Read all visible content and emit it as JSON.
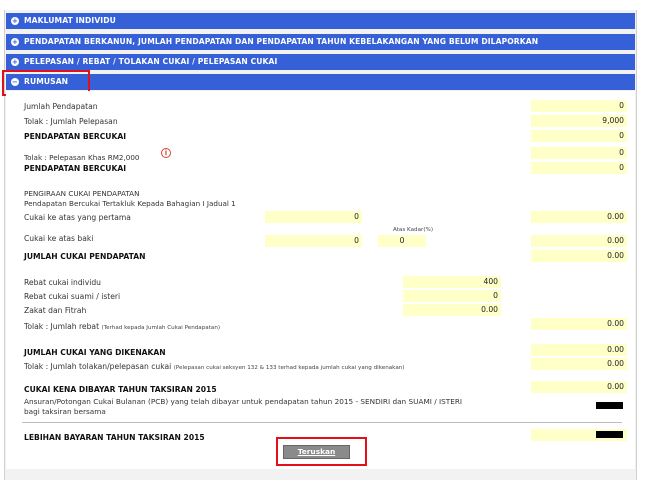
{
  "sections": [
    {
      "label": "MAKLUMAT INDIVIDU",
      "icon": "plus-icon"
    },
    {
      "label": "PENDAPATAN BERKANUN, JUMLAH PENDAPATAN DAN PENDAPATAN TAHUN KEBELAKANGAN YANG BELUM DILAPORKAN",
      "icon": "plus-icon"
    },
    {
      "label": "PELEPASAN / REBAT / TOLAKAN CUKAI / PELEPASAN CUKAI",
      "icon": "plus-icon"
    },
    {
      "label": "RUMUSAN",
      "icon": "minus-icon"
    }
  ],
  "summary": {
    "jumlah_pendapatan": {
      "label": "Jumlah Pendapatan",
      "value": "0"
    },
    "tolak_jumlah_pelepasan": {
      "label": "Tolak : Jumlah Pelepasan",
      "value": "9,000"
    },
    "pendapatan_bercukai_1": {
      "label": "PENDAPATAN BERCUKAI",
      "value": "0"
    },
    "pelepasan_khas": {
      "label": "Tolak : Pelepasan Khas RM2,000",
      "value": "0"
    },
    "pendapatan_bercukai_2": {
      "label": "PENDAPATAN BERCUKAI",
      "value": "0"
    },
    "pengiraan_title": "PENGIRAAN CUKAI PENDAPATAN",
    "pengiraan_sub": "Pendapatan Bercukai Tertakluk Kepada Bahagian I Jadual 1",
    "cukai_pertama": {
      "label": "Cukai ke atas yang pertama",
      "amount": "0",
      "value": "0.00"
    },
    "kadar_label": "Atas Kadar(%)",
    "cukai_baki": {
      "label": "Cukai ke atas baki",
      "amount": "0",
      "rate": "0",
      "value": "0.00"
    },
    "jumlah_cukai_pendapatan": {
      "label": "JUMLAH CUKAI PENDAPATAN",
      "value": "0.00"
    },
    "rebat_individu": {
      "label": "Rebat cukai individu",
      "value": "400"
    },
    "rebat_suami_isteri": {
      "label": "Rebat cukai suami / isteri",
      "value": "0"
    },
    "zakat": {
      "label": "Zakat dan Fitrah",
      "value": "0.00"
    },
    "tolak_jumlah_rebat": {
      "label": "Tolak : Jumlah rebat",
      "note": "(Terhad kepada Jumlah Cukai Pendapatan)",
      "value": "0.00"
    },
    "jumlah_cukai_dikenakan": {
      "label": "JUMLAH CUKAI YANG DIKENAKAN",
      "value": "0.00"
    },
    "tolakan_pelepasan": {
      "label": "Tolak : Jumlah tolakan/pelepasan cukai",
      "note": "(Pelepasan cukai seksyen 132 & 133 terhad kepada jumlah cukai yang dikenakan)",
      "value": "0.00"
    },
    "cukai_kena_dibayar": {
      "label": "CUKAI KENA DIBAYAR TAHUN TAKSIRAN 2015",
      "value": "0.00"
    },
    "pcb_line1": "Ansuran/Potongan Cukai Bulanan (PCB) yang telah dibayar untuk pendapatan tahun 2015 - SENDIRI dan SUAMI / ISTERI",
    "pcb_line2": "bagi taksiran bersama",
    "lebihan_bayaran": {
      "label": "LEBIHAN BAYARAN TAHUN TAKSIRAN 2015"
    }
  },
  "actions": {
    "continue_label": "Teruskan"
  },
  "icons": {
    "info": "info-icon"
  },
  "colors": {
    "section_bar": "#3560d8",
    "field_bg": "#ffffc8",
    "highlight": "#e3101a"
  }
}
